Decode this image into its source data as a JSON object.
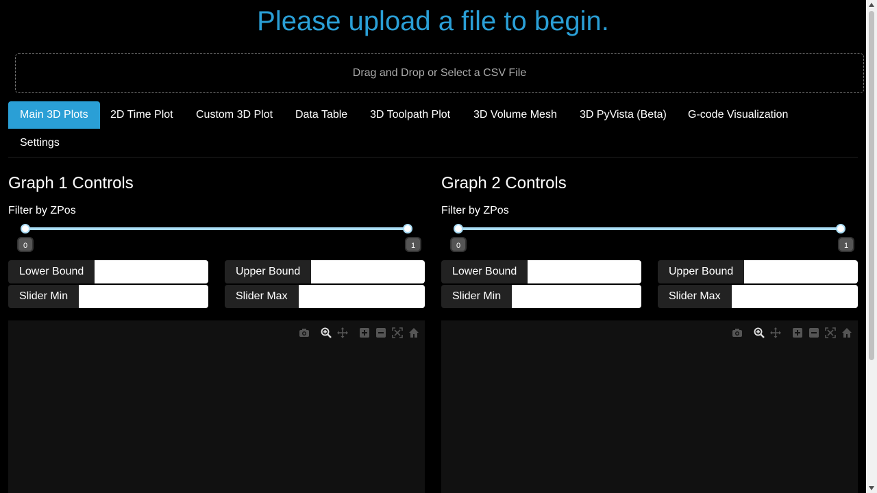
{
  "header": {
    "title": "Please upload a file to begin."
  },
  "upload": {
    "label": "Drag and Drop or Select a CSV File"
  },
  "tabs": [
    {
      "label": "Main 3D Plots",
      "active": true
    },
    {
      "label": "2D Time Plot"
    },
    {
      "label": "Custom 3D Plot"
    },
    {
      "label": "Data Table"
    },
    {
      "label": "3D Toolpath Plot"
    },
    {
      "label": "3D Volume Mesh"
    },
    {
      "label": "3D PyVista (Beta)"
    },
    {
      "label": "G-code Visualization"
    },
    {
      "label": "Settings"
    }
  ],
  "graph1": {
    "heading": "Graph 1 Controls",
    "filter_label": "Filter by ZPos",
    "slider": {
      "min_label": "0",
      "max_label": "1",
      "low": 0,
      "high": 1
    },
    "lower_bound_label": "Lower Bound",
    "lower_bound_value": "",
    "upper_bound_label": "Upper Bound",
    "upper_bound_value": "",
    "slider_min_label": "Slider Min",
    "slider_min_value": "",
    "slider_max_label": "Slider Max",
    "slider_max_value": ""
  },
  "graph2": {
    "heading": "Graph 2 Controls",
    "filter_label": "Filter by ZPos",
    "slider": {
      "min_label": "0",
      "max_label": "1",
      "low": 0,
      "high": 1
    },
    "lower_bound_label": "Lower Bound",
    "lower_bound_value": "",
    "upper_bound_label": "Upper Bound",
    "upper_bound_value": "",
    "slider_min_label": "Slider Min",
    "slider_min_value": "",
    "slider_max_label": "Slider Max",
    "slider_max_value": ""
  },
  "modebar": [
    "camera-icon",
    "zoom-icon",
    "pan-icon",
    "zoom-in-icon",
    "zoom-out-icon",
    "autoscale-icon",
    "home-icon"
  ],
  "colors": {
    "accent": "#2a9fd6",
    "background": "#000000",
    "plot_background": "#111111",
    "slider_track": "#a9dcf5"
  }
}
